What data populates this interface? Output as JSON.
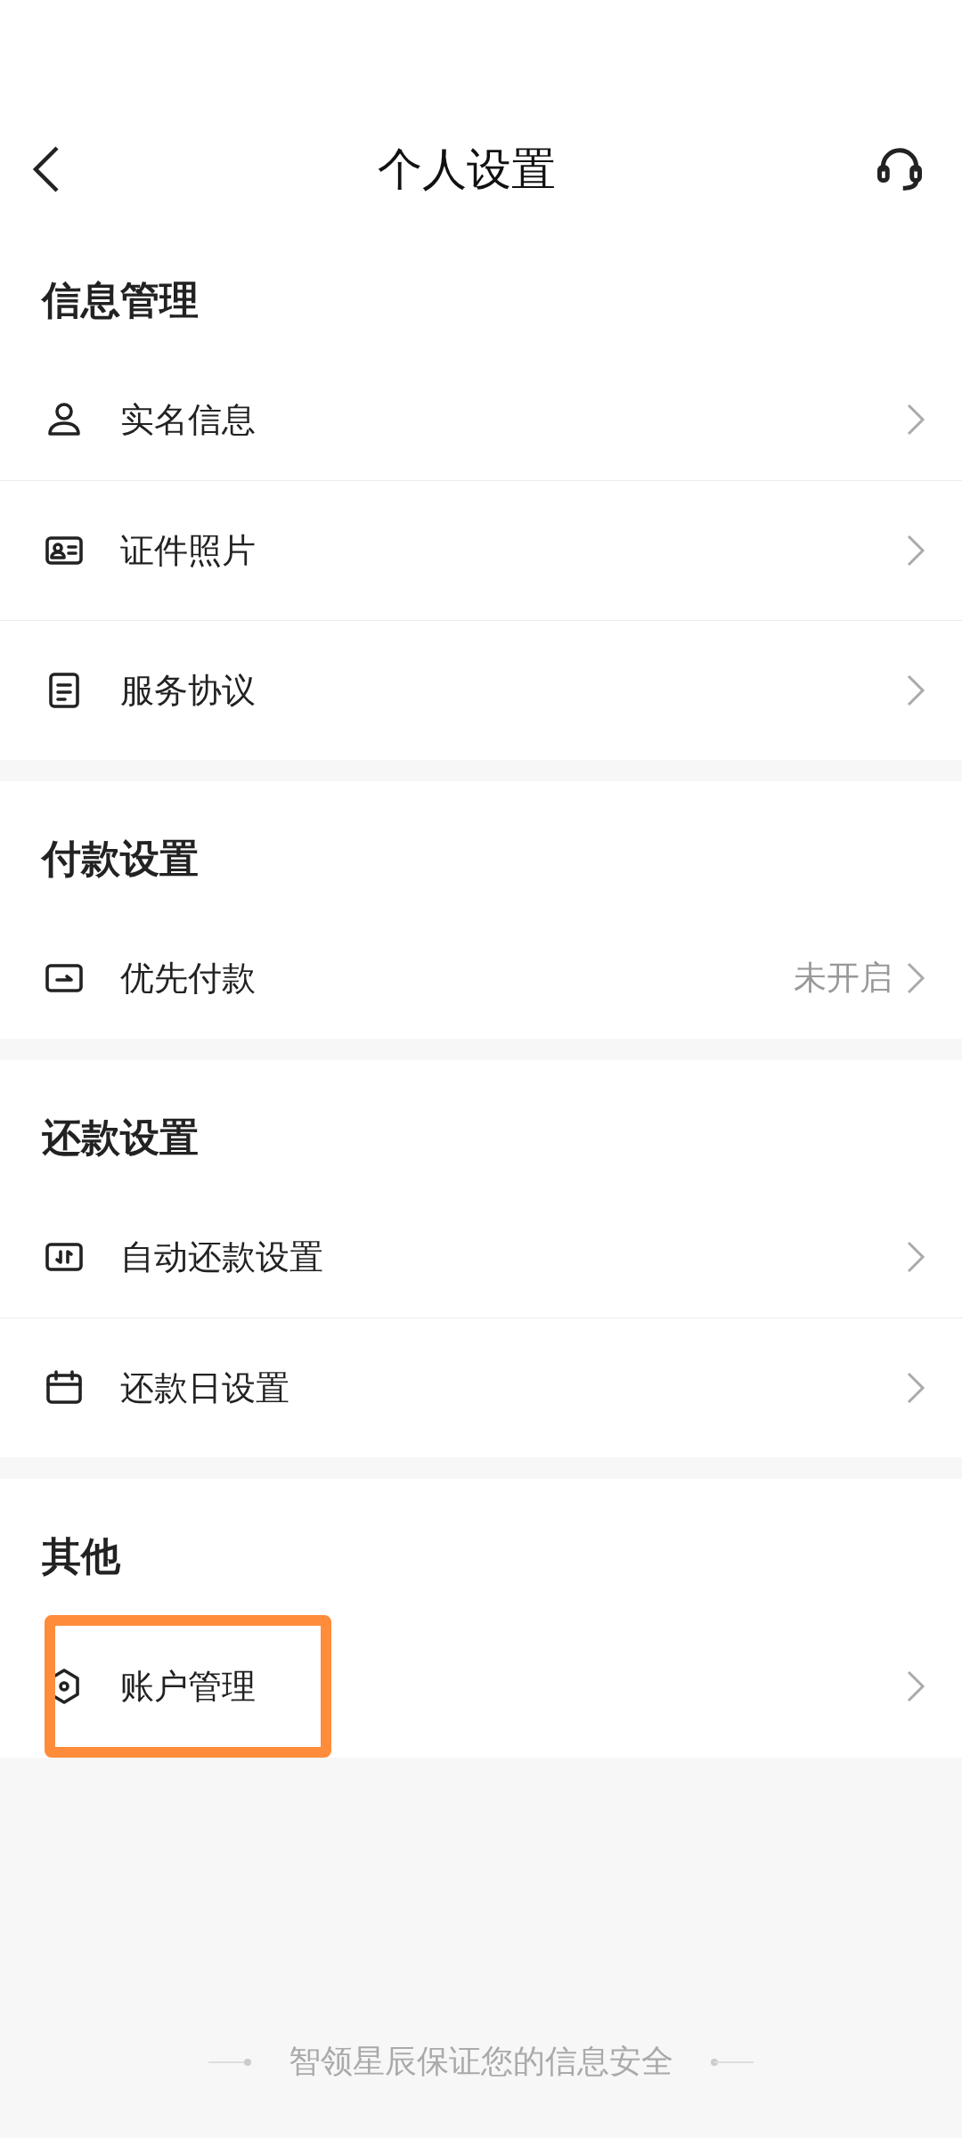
{
  "nav": {
    "title": "个人设置"
  },
  "sections": [
    {
      "title": "信息管理",
      "items": [
        {
          "kind": "person",
          "label": "实名信息",
          "highlighted": false
        },
        {
          "kind": "card",
          "label": "证件照片",
          "highlighted": false
        },
        {
          "kind": "document",
          "label": "服务协议",
          "highlighted": false
        }
      ]
    },
    {
      "title": "付款设置",
      "items": [
        {
          "kind": "pay",
          "label": "优先付款",
          "value": "未开启",
          "highlighted": false
        }
      ]
    },
    {
      "title": "还款设置",
      "items": [
        {
          "kind": "auto",
          "label": "自动还款设置",
          "highlighted": false
        },
        {
          "kind": "calendar",
          "label": "还款日设置",
          "highlighted": false
        }
      ]
    },
    {
      "title": "其他",
      "items": [
        {
          "kind": "account",
          "label": "账户管理",
          "highlighted": true
        }
      ]
    }
  ],
  "footer": "智领星辰保证您的信息安全"
}
